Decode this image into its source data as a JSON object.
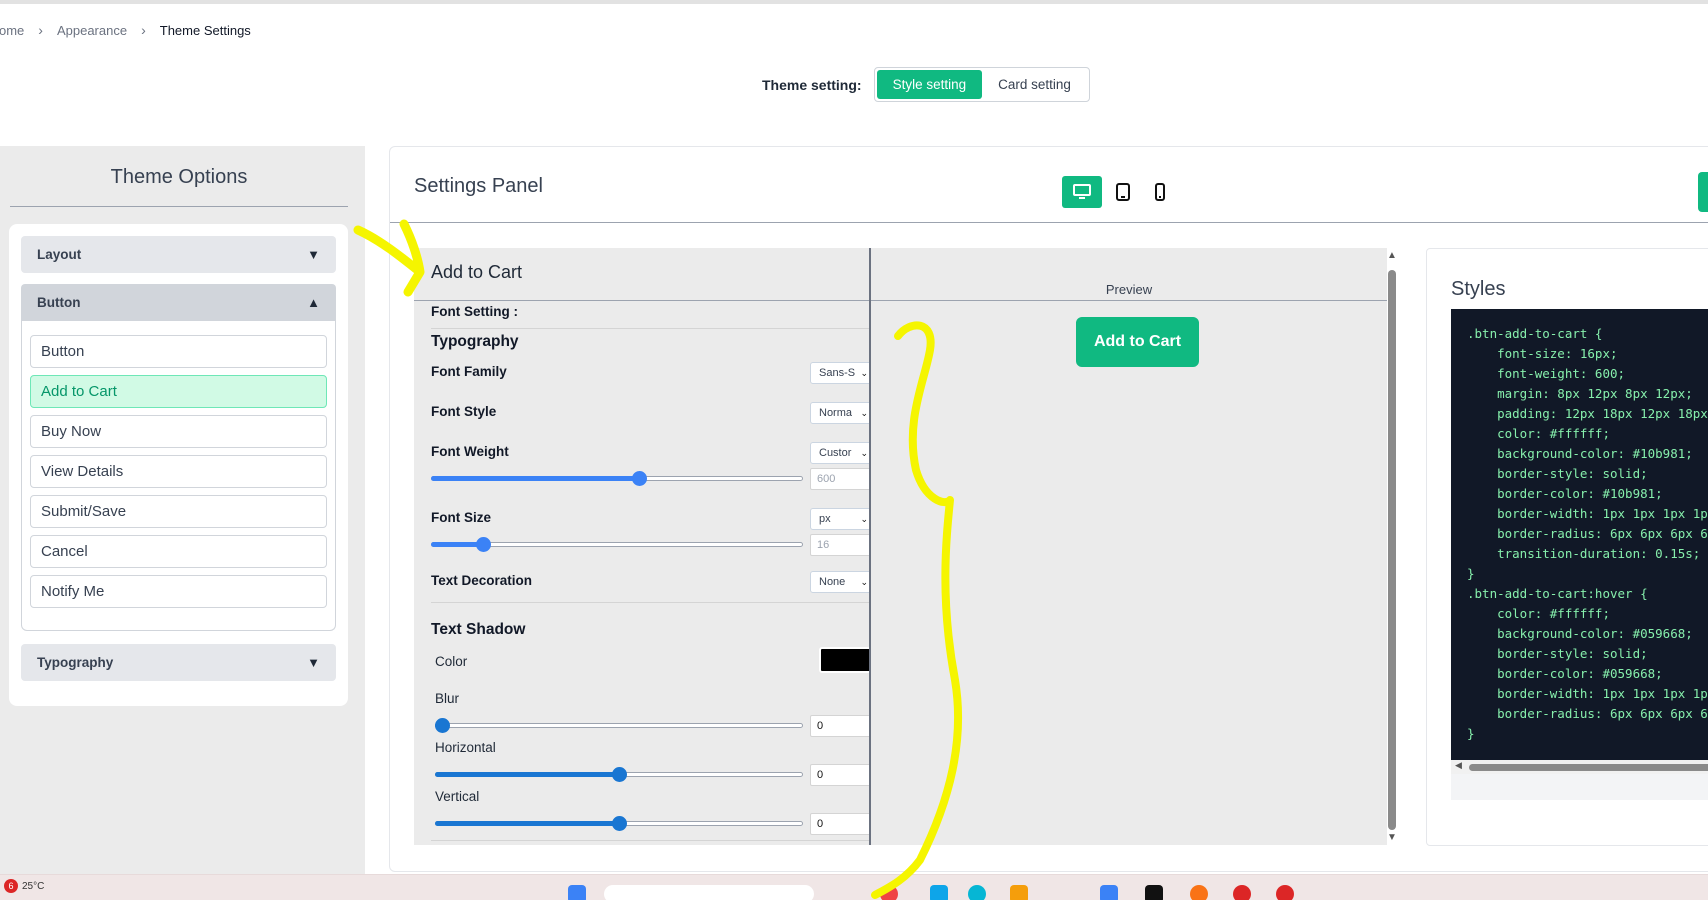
{
  "breadcrumb": {
    "items": [
      "ome",
      "Appearance",
      "Theme Settings"
    ]
  },
  "theme_setting": {
    "label": "Theme setting:",
    "tabs": [
      "Style setting",
      "Card setting"
    ],
    "active": "Style setting"
  },
  "theme_options": {
    "title": "Theme Options",
    "sections": [
      {
        "label": "Layout",
        "open": false
      },
      {
        "label": "Button",
        "open": true
      },
      {
        "label": "Typography",
        "open": false
      }
    ],
    "button_items": [
      "Button",
      "Add to Cart",
      "Buy Now",
      "View Details",
      "Submit/Save",
      "Cancel",
      "Notify Me"
    ],
    "active_item": "Add to Cart"
  },
  "settings_panel": {
    "title": "Settings Panel",
    "devices": [
      "desktop-icon",
      "tablet-icon",
      "mobile-icon"
    ],
    "active_device": "desktop"
  },
  "editor": {
    "title": "Add to Cart",
    "font_setting_label": "Font Setting :",
    "typography_heading": "Typography",
    "font_family": {
      "label": "Font Family",
      "value": "Sans-S"
    },
    "font_style": {
      "label": "Font Style",
      "value": "Norma"
    },
    "font_weight": {
      "label": "Font Weight",
      "value": "Custor",
      "number": "600",
      "slider": 0.56
    },
    "font_size": {
      "label": "Font Size",
      "unit": "px",
      "number": "16",
      "slider": 0.14
    },
    "text_decoration": {
      "label": "Text Decoration",
      "value": "None"
    },
    "text_shadow_heading": "Text Shadow",
    "shadow_color": {
      "label": "Color",
      "value": "#000000"
    },
    "blur": {
      "label": "Blur",
      "number": "0",
      "slider": 0.0
    },
    "horizontal": {
      "label": "Horizontal",
      "number": "0",
      "slider": 0.5
    },
    "vertical": {
      "label": "Vertical",
      "number": "0",
      "slider": 0.5
    }
  },
  "preview": {
    "label": "Preview",
    "button_text": "Add to Cart"
  },
  "styles": {
    "title": "Styles",
    "code": ".btn-add-to-cart {\n    font-size: 16px;\n    font-weight: 600;\n    margin: 8px 12px 8px 12px;\n    padding: 12px 18px 12px 18px;\n    color: #ffffff;\n    background-color: #10b981;\n    border-style: solid;\n    border-color: #10b981;\n    border-width: 1px 1px 1px 1px;\n    border-radius: 6px 6px 6px 6px;\n    transition-duration: 0.15s;\n}\n.btn-add-to-cart:hover {\n    color: #ffffff;\n    background-color: #059668;\n    border-style: solid;\n    border-color: #059668;\n    border-width: 1px 1px 1px 1px;\n    border-radius: 6px 6px 6px 6px;\n}"
  },
  "taskbar": {
    "weather_badge": "6",
    "temperature": "25°C"
  },
  "colors": {
    "accent": "#10b981",
    "accent_dark": "#059668",
    "slider": "#3b82f6",
    "annotation": "#f5f500"
  }
}
